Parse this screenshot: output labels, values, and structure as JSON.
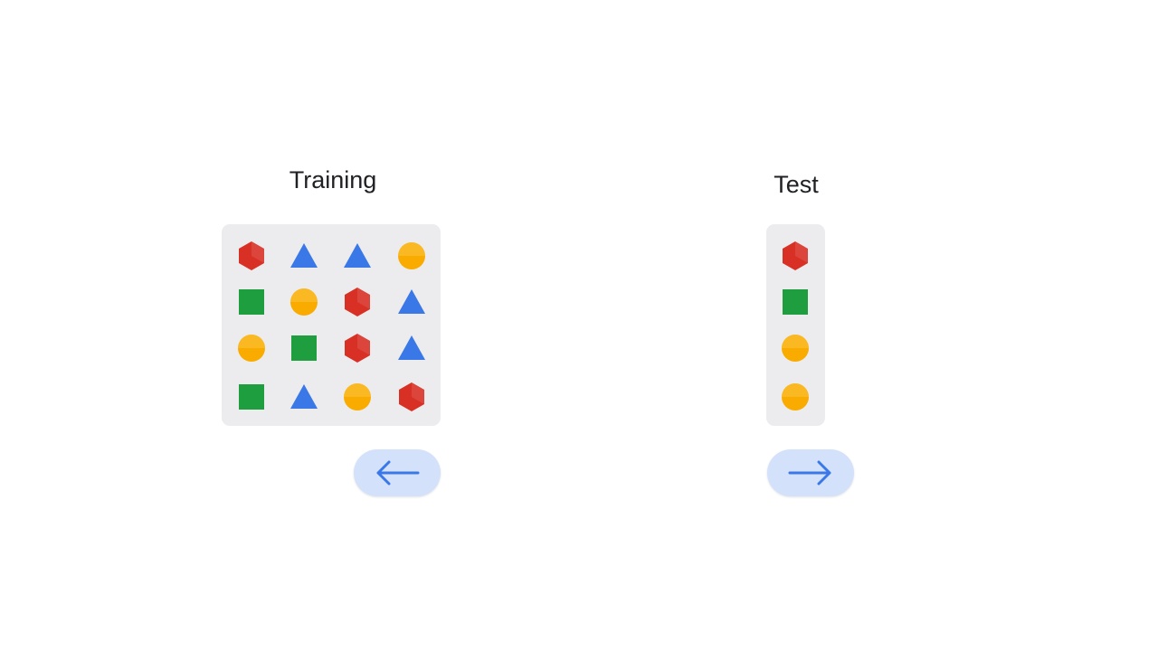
{
  "training": {
    "title": "Training",
    "grid": [
      [
        "hexagon",
        "triangle",
        "triangle",
        "circle"
      ],
      [
        "square",
        "circle",
        "hexagon",
        "triangle"
      ],
      [
        "circle",
        "square",
        "hexagon",
        "triangle"
      ],
      [
        "square",
        "triangle",
        "circle",
        "hexagon"
      ]
    ]
  },
  "test": {
    "title": "Test",
    "column": [
      "hexagon",
      "square",
      "circle",
      "circle"
    ]
  },
  "buttons": {
    "prev_icon": "arrow-left-icon",
    "next_icon": "arrow-right-icon"
  },
  "colors": {
    "hexagon": "#d93025",
    "triangle": "#3b78e7",
    "circle": "#f9ab00",
    "square": "#1e9e3e",
    "panel": "#ececee",
    "button": "#d3e1fb",
    "arrow": "#3b78e7"
  }
}
